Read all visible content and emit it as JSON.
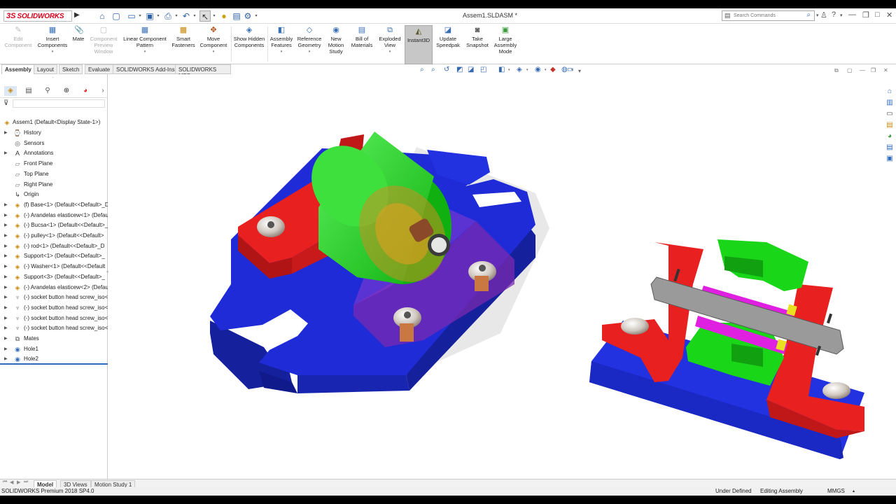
{
  "titlebar": {
    "logo_ds": "3S",
    "logo_text": "SOLIDWORKS",
    "document_title": "Assem1.SLDASM *",
    "search_placeholder": "Search Commands"
  },
  "ribbon": {
    "buttons": [
      {
        "label": "Edit Component",
        "icon": "edit-component-icon",
        "disabled": true
      },
      {
        "label": "Insert Components",
        "icon": "insert-components-icon",
        "disabled": false
      },
      {
        "label": "Mate",
        "icon": "mate-icon",
        "disabled": false
      },
      {
        "label": "Component Preview Window",
        "icon": "component-preview-icon",
        "disabled": true
      },
      {
        "label": "Linear Component Pattern",
        "icon": "linear-pattern-icon",
        "disabled": false
      },
      {
        "label": "Smart Fasteners",
        "icon": "smart-fasteners-icon",
        "disabled": false
      },
      {
        "label": "Move Component",
        "icon": "move-component-icon",
        "disabled": false
      },
      {
        "label": "Show Hidden Components",
        "icon": "show-hidden-icon",
        "disabled": false
      },
      {
        "label": "Assembly Features",
        "icon": "assembly-features-icon",
        "disabled": false
      },
      {
        "label": "Reference Geometry",
        "icon": "reference-geometry-icon",
        "disabled": false
      },
      {
        "label": "New Motion Study",
        "icon": "motion-study-icon",
        "disabled": false
      },
      {
        "label": "Bill of Materials",
        "icon": "bom-icon",
        "disabled": false
      },
      {
        "label": "Exploded View",
        "icon": "exploded-view-icon",
        "disabled": false
      },
      {
        "label": "Instant3D",
        "icon": "instant3d-icon",
        "disabled": false,
        "active": true
      },
      {
        "label": "Update Speedpak",
        "icon": "speedpak-icon",
        "disabled": false
      },
      {
        "label": "Take Snapshot",
        "icon": "snapshot-icon",
        "disabled": false
      },
      {
        "label": "Large Assembly Mode",
        "icon": "large-assembly-icon",
        "disabled": false
      }
    ]
  },
  "command_tabs": [
    "Assembly",
    "Layout",
    "Sketch",
    "Evaluate",
    "SOLIDWORKS Add-Ins",
    "SOLIDWORKS MBD"
  ],
  "tree": {
    "root": "Assem1  (Default<Display State-1>)",
    "items": [
      {
        "label": "History",
        "icon": "history-icon",
        "expandable": true
      },
      {
        "label": "Sensors",
        "icon": "sensors-icon",
        "expandable": false
      },
      {
        "label": "Annotations",
        "icon": "annotations-icon",
        "expandable": true
      },
      {
        "label": "Front Plane",
        "icon": "plane-icon",
        "expandable": false
      },
      {
        "label": "Top Plane",
        "icon": "plane-icon",
        "expandable": false
      },
      {
        "label": "Right Plane",
        "icon": "plane-icon",
        "expandable": false
      },
      {
        "label": "Origin",
        "icon": "origin-icon",
        "expandable": false
      },
      {
        "label": "(f) Base<1> (Default<<Default>_D",
        "icon": "part-icon",
        "expandable": true
      },
      {
        "label": "(-) Arandelas elasticew<1> (Defau",
        "icon": "part-icon",
        "expandable": true
      },
      {
        "label": "(-) Bucsa<1> (Default<<Default>_",
        "icon": "part-icon",
        "expandable": true
      },
      {
        "label": "(-) pulley<1> (Default<<Default>",
        "icon": "part-icon",
        "expandable": true
      },
      {
        "label": "(-) rod<1> (Default<<Default>_D",
        "icon": "part-icon",
        "expandable": true
      },
      {
        "label": "Support<1> (Default<<Default>_",
        "icon": "part-icon",
        "expandable": true
      },
      {
        "label": "(-) Washer<1> (Default<<Default",
        "icon": "part-icon",
        "expandable": true
      },
      {
        "label": "Support<3> (Default<<Default>_",
        "icon": "part-icon",
        "expandable": true
      },
      {
        "label": "(-) Arandelas elasticew<2> (Defau",
        "icon": "part-icon",
        "expandable": true
      },
      {
        "label": "(-) socket button head screw_iso<",
        "icon": "screw-icon",
        "expandable": true
      },
      {
        "label": "(-) socket button head screw_iso<",
        "icon": "screw-icon",
        "expandable": true
      },
      {
        "label": "(-) socket button head screw_iso<",
        "icon": "screw-icon",
        "expandable": true
      },
      {
        "label": "(-) socket button head screw_iso<",
        "icon": "screw-icon",
        "expandable": true
      },
      {
        "label": "Mates",
        "icon": "mates-icon",
        "expandable": true
      },
      {
        "label": "Hole1",
        "icon": "hole-icon",
        "expandable": true
      },
      {
        "label": "Hole2",
        "icon": "hole-icon",
        "expandable": true
      }
    ]
  },
  "bottom_tabs": [
    "Model",
    "3D Views",
    "Motion Study 1"
  ],
  "status": {
    "product": "SOLIDWORKS Premium 2018 SP4.0",
    "defined": "Under Defined",
    "mode": "Editing Assembly",
    "units": "MMGS"
  },
  "colors": {
    "base": "#1f2bd6",
    "support": "#e8201f",
    "pulley": "#19d619",
    "rod": "#9a9a9a",
    "bushing": "#e020e0",
    "washer": "#e8e020",
    "accent": "#2e6ac0",
    "brand": "#d6001c"
  }
}
